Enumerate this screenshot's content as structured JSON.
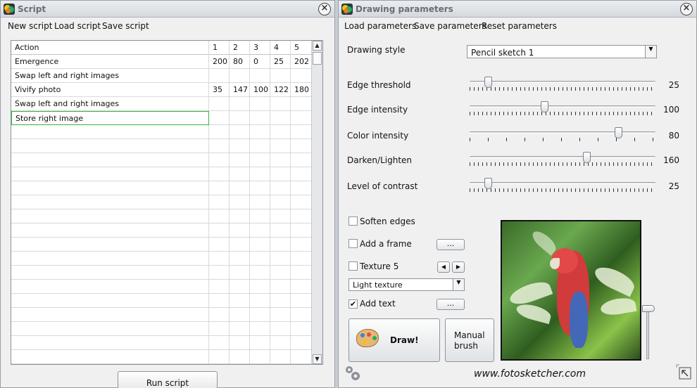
{
  "script_window": {
    "title": "Script",
    "menu": [
      "New script",
      "Load script",
      "Save script"
    ],
    "grid": {
      "columns": [
        "Action",
        "1",
        "2",
        "3",
        "4",
        "5"
      ],
      "rows": [
        [
          "Emergence",
          "200",
          "80",
          "0",
          "25",
          "202"
        ],
        [
          "Swap left and right images",
          "",
          "",
          "",
          "",
          ""
        ],
        [
          "Vivify photo",
          "35",
          "147",
          "100",
          "122",
          "180"
        ],
        [
          "Swap left and right images",
          "",
          "",
          "",
          "",
          ""
        ],
        [
          "Store right image",
          "",
          "",
          "",
          "",
          ""
        ]
      ],
      "empty_rows": 17
    },
    "run_button": "Run script"
  },
  "params_window": {
    "title": "Drawing parameters",
    "menu": [
      "Load parameters",
      "Save parameters",
      "Reset parameters"
    ],
    "drawing_style_label": "Drawing style",
    "drawing_style_value": "Pencil sketch 1",
    "sliders": [
      {
        "label": "Edge threshold",
        "value": "25",
        "fraction": 0.1
      },
      {
        "label": "Edge intensity",
        "value": "100",
        "fraction": 0.4
      },
      {
        "label": "Color intensity",
        "value": "80",
        "fraction": 0.8
      },
      {
        "label": "Darken/Lighten",
        "value": "160",
        "fraction": 0.63
      },
      {
        "label": "Level of contrast",
        "value": "25",
        "fraction": 0.1
      }
    ],
    "soften_edges": {
      "label": "Soften edges",
      "checked": false
    },
    "add_frame": {
      "label": "Add a frame",
      "checked": false,
      "button": "..."
    },
    "texture": {
      "label": "Texture 5",
      "checked": false,
      "prev": "◀",
      "next": "▶"
    },
    "texture_type": "Light texture",
    "add_text": {
      "label": "Add text",
      "checked": true,
      "button": "..."
    },
    "draw_button": "Draw!",
    "manual_brush_button": [
      "Manual",
      "brush"
    ],
    "website": "www.fotosketcher.com"
  },
  "icons": {
    "close": "close-icon",
    "app": "fotosketcher-logo-icon",
    "palette": "palette-icon",
    "settings": "gear-icon",
    "resize": "resize-icon"
  }
}
